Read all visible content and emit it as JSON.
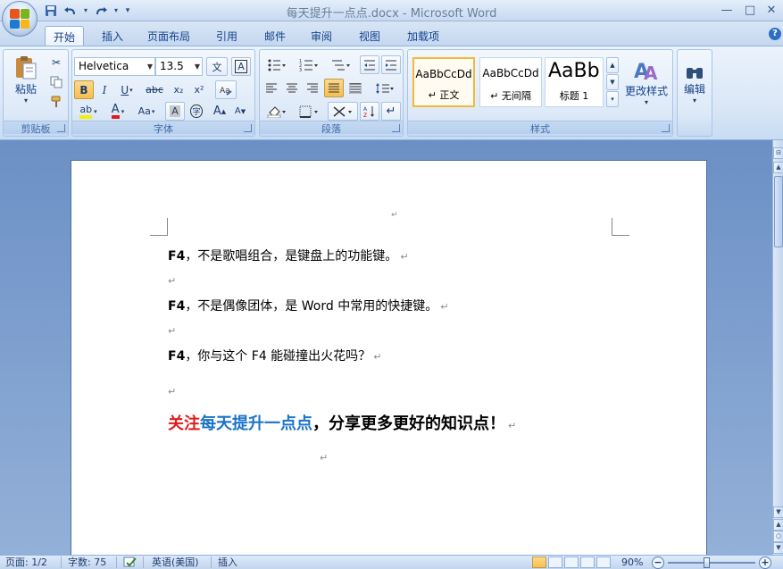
{
  "window": {
    "title": "每天提升一点点.docx - Microsoft Word",
    "controls": {
      "minimize": "—",
      "maximize": "□",
      "close": "✕"
    }
  },
  "qat": {
    "save_icon": "save-icon",
    "undo_icon": "undo-icon",
    "redo_icon": "redo-icon",
    "customize": "▾"
  },
  "tabs": [
    {
      "label": "开始",
      "active": true
    },
    {
      "label": "插入"
    },
    {
      "label": "页面布局"
    },
    {
      "label": "引用"
    },
    {
      "label": "邮件"
    },
    {
      "label": "审阅"
    },
    {
      "label": "视图"
    },
    {
      "label": "加载项"
    }
  ],
  "help": "?",
  "ribbon": {
    "clipboard": {
      "label": "剪贴板",
      "paste": "粘贴"
    },
    "font": {
      "label": "字体",
      "font_name": "Helvetica",
      "font_size": "13.5",
      "bold": "B",
      "italic": "I",
      "underline": "U",
      "strike": "abc",
      "subscript": "x₂",
      "superscript": "x²",
      "highlight": "ab",
      "font_color": "A",
      "change_case": "Aa",
      "char_border": "A",
      "enclose": "字",
      "grow": "A",
      "shrink": "A",
      "phonetic": "文",
      "clear": "A"
    },
    "paragraph": {
      "label": "段落"
    },
    "styles": {
      "label": "样式",
      "items": [
        {
          "sample": "AaBbCcDd",
          "name": "↵ 正文"
        },
        {
          "sample": "AaBbCcDd",
          "name": "↵ 无间隔"
        },
        {
          "sample": "AaBb",
          "name": "标题 1"
        }
      ],
      "change_styles": "更改样式"
    },
    "editing": {
      "label": "编辑"
    }
  },
  "document": {
    "lines": [
      {
        "bold": "F4",
        "text": "，不是歌唱组合，是键盘上的功能键。"
      },
      {
        "bold": "F4",
        "text": "，不是偶像团体，是 Word 中常用的快捷键。"
      },
      {
        "bold": "F4",
        "text": "，你与这个 F4 能碰撞出火花吗？"
      }
    ],
    "promo": {
      "part1": "关注",
      "part2": "每天提升一点点",
      "part3": "，分享更多更好的知识点！",
      "color1": "#e01b1b",
      "color2": "#1a73c6",
      "color3": "#000000"
    },
    "para_mark": "↵"
  },
  "status": {
    "page": "页面: 1/2",
    "words": "字数: 75",
    "language": "英语(美国)",
    "mode": "插入",
    "zoom": "90%",
    "zoom_out": "−",
    "zoom_in": "+",
    "zoom_value": 0.9
  }
}
